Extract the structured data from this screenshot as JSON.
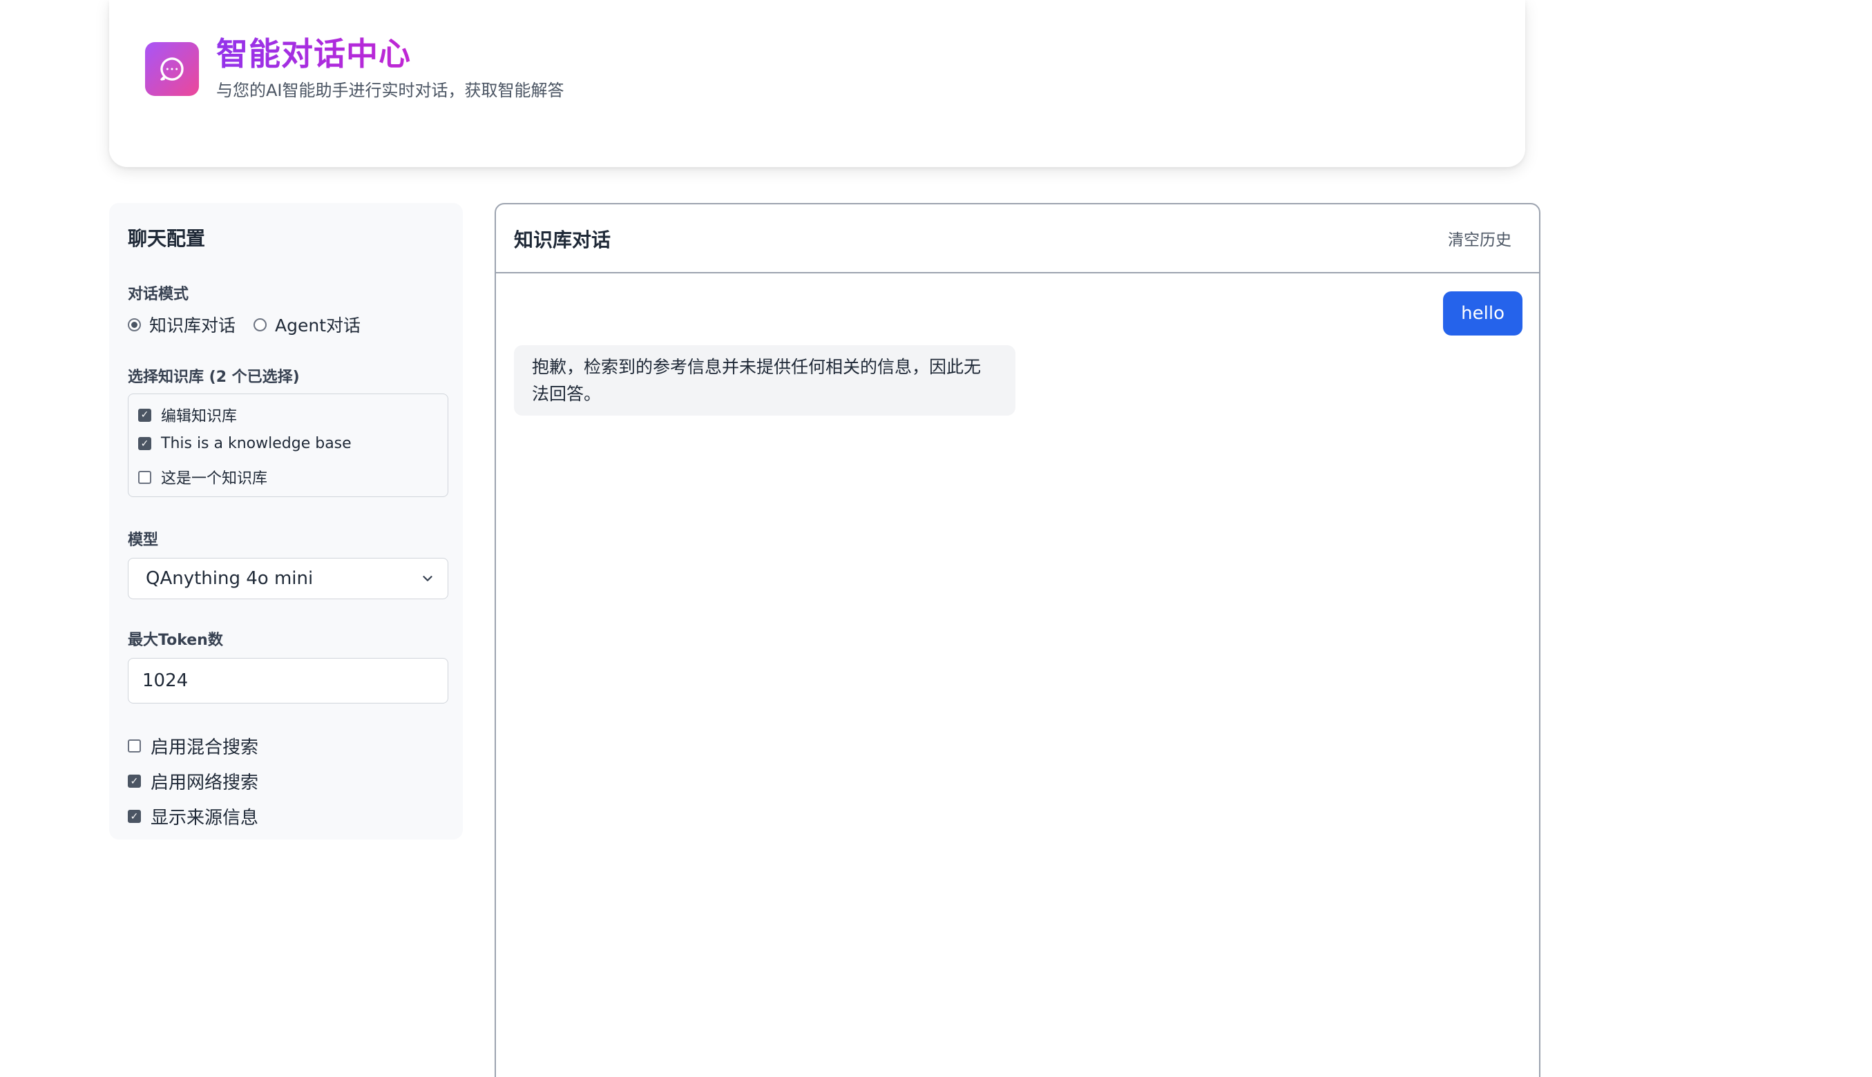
{
  "header": {
    "title": "智能对话中心",
    "subtitle": "与您的AI智能助手进行实时对话，获取智能解答",
    "logo_icon": "chat-bubble-icon",
    "accent_gradient": [
      "#a855f7",
      "#ec4899"
    ]
  },
  "sidebar": {
    "title": "聊天配置",
    "mode_label": "对话模式",
    "modes": [
      {
        "label": "知识库对话",
        "checked": true
      },
      {
        "label": "Agent对话",
        "checked": false
      }
    ],
    "kb_label": "选择知识库 (2 个已选择)",
    "knowledge_bases": [
      {
        "label": "编辑知识库",
        "checked": true
      },
      {
        "label": "This is a knowledge base",
        "checked": true
      },
      {
        "label": "这是一个知识库",
        "checked": false
      }
    ],
    "model_label": "模型",
    "model_value": "QAnything 4o mini",
    "max_tokens_label": "最大Token数",
    "max_tokens_value": "1024",
    "options": [
      {
        "label": "启用混合搜索",
        "checked": false
      },
      {
        "label": "启用网络搜索",
        "checked": true
      },
      {
        "label": "显示来源信息",
        "checked": true
      }
    ]
  },
  "chat": {
    "title": "知识库对话",
    "clear_label": "清空历史",
    "messages": [
      {
        "role": "user",
        "text": "hello"
      },
      {
        "role": "assistant",
        "text": "抱歉，检索到的参考信息并未提供任何相关的信息，因此无法回答。"
      }
    ],
    "user_bubble_color": "#2563eb"
  }
}
